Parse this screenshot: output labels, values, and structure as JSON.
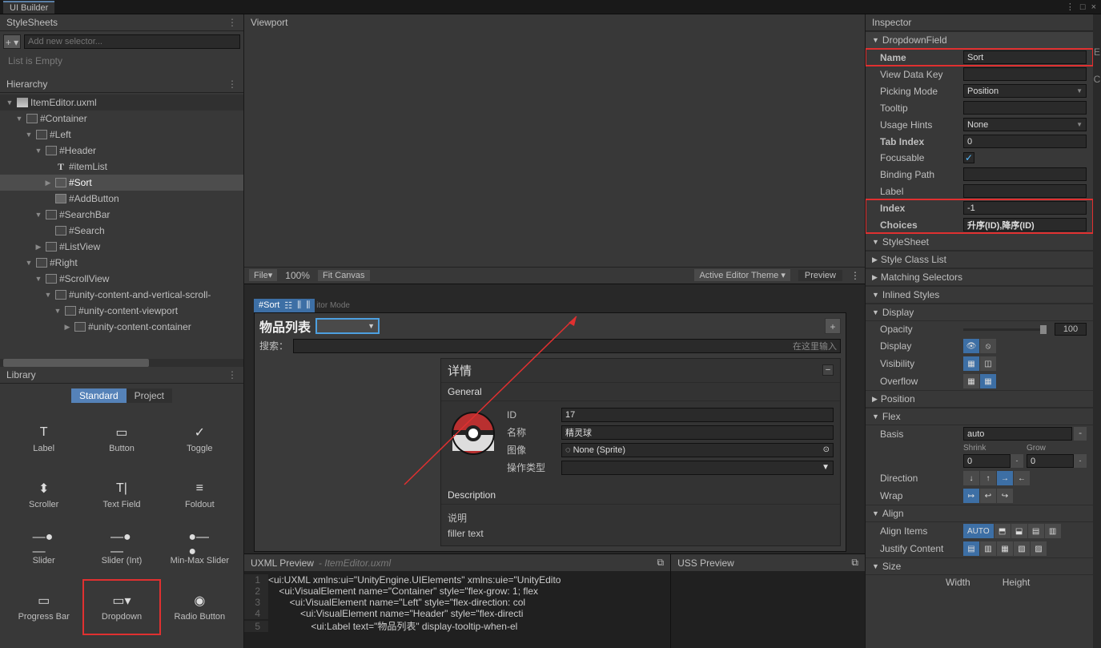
{
  "window_title": "UI Builder",
  "stylesheets": {
    "title": "StyleSheets",
    "add_placeholder": "Add new selector...",
    "empty": "List is Empty"
  },
  "hierarchy": {
    "title": "Hierarchy",
    "root": "ItemEditor.uxml",
    "items": [
      "#Container",
      "#Left",
      "#Header",
      "#itemList",
      "#Sort",
      "#AddButton",
      "#SearchBar",
      "#Search",
      "#ListView",
      "#Right",
      "#ScrollView",
      "#unity-content-and-vertical-scroll-",
      "#unity-content-viewport",
      "#unity-content-container"
    ]
  },
  "library": {
    "title": "Library",
    "tabs": [
      "Standard",
      "Project"
    ],
    "items": [
      "Label",
      "Button",
      "Toggle",
      "Scroller",
      "Text Field",
      "Foldout",
      "Slider",
      "Slider (Int)",
      "Min-Max Slider",
      "Progress Bar",
      "Dropdown",
      "Radio Button"
    ]
  },
  "viewport": {
    "title": "Viewport",
    "file": "File",
    "zoom": "100%",
    "fit": "Fit Canvas",
    "theme": "Active Editor Theme",
    "preview": "Preview",
    "sel_chip": "#Sort",
    "after_chip": "itor Mode",
    "items_title": "物品列表",
    "plus": "+",
    "search_label": "搜索：",
    "search_ph": "在这里输入",
    "details_title": "详情",
    "general_title": "General",
    "fields": {
      "id_l": "ID",
      "id_v": "17",
      "name_l": "名称",
      "name_v": "精灵球",
      "img_l": "图像",
      "img_v": "None (Sprite)",
      "op_l": "操作类型"
    },
    "desc_title": "Description",
    "desc_l": "说明",
    "desc_v": "filler text"
  },
  "uxml": {
    "title": "UXML Preview",
    "sub": "- ItemEditor.uxml",
    "lines": [
      "<ui:UXML xmlns:ui=\"UnityEngine.UIElements\" xmlns:uie=\"UnityEdito",
      "    <ui:VisualElement name=\"Container\" style=\"flex-grow: 1; flex",
      "        <ui:VisualElement name=\"Left\" style=\"flex-direction: col",
      "            <ui:VisualElement name=\"Header\" style=\"flex-directi",
      "                <ui:Label text=\"物品列表\" display-tooltip-when-el"
    ]
  },
  "uss": {
    "title": "USS Preview"
  },
  "inspector": {
    "title": "Inspector",
    "dropdown_header": "DropdownField",
    "name_l": "Name",
    "name_v": "Sort",
    "vdk_l": "View Data Key",
    "pick_l": "Picking Mode",
    "pick_v": "Position",
    "tooltip_l": "Tooltip",
    "usage_l": "Usage Hints",
    "usage_v": "None",
    "tab_l": "Tab Index",
    "tab_v": "0",
    "focus_l": "Focusable",
    "focus_v": "✓",
    "bind_l": "Binding Path",
    "label_l": "Label",
    "index_l": "Index",
    "index_v": "-1",
    "choices_l": "Choices",
    "choices_v": "升序(ID),降序(ID)",
    "ss": "StyleSheet",
    "scl": "Style Class List",
    "ms": "Matching Selectors",
    "is": "Inlined Styles",
    "display": "Display",
    "opacity_l": "Opacity",
    "opacity_v": "100",
    "disp_l": "Display",
    "vis_l": "Visibility",
    "ovf_l": "Overflow",
    "position": "Position",
    "flex": "Flex",
    "basis_l": "Basis",
    "basis_v": "auto",
    "shrink_l": "Shrink",
    "shrink_v": "0",
    "grow_l": "Grow",
    "grow_v": "0",
    "dir_l": "Direction",
    "wrap_l": "Wrap",
    "align": "Align",
    "ai_l": "Align Items",
    "ai_auto": "AUTO",
    "jc_l": "Justify Content",
    "size": "Size",
    "width_l": "Width",
    "height_l": "Height"
  }
}
